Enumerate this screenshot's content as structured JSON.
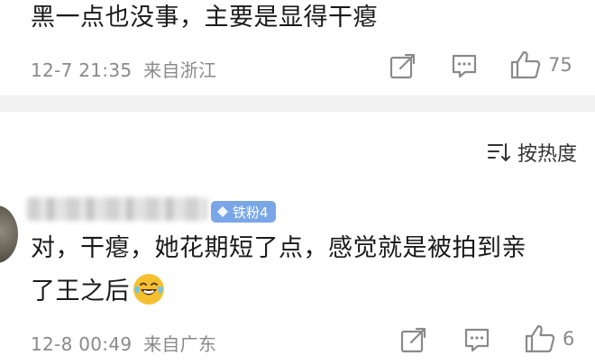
{
  "comment1": {
    "text": "黑一点也没事，主要是显得干瘪",
    "time": "12-7 21:35",
    "source": "来自浙江",
    "like_count": "75",
    "icons": [
      "share-icon",
      "reply-icon",
      "like-icon"
    ]
  },
  "sort": {
    "label": "按热度",
    "icon": "sort-icon"
  },
  "comment2": {
    "badge_label": "铁粉4",
    "badge_icon": "diamond-icon",
    "text_line1": "对，干瘪，她花期短了点，感觉就是被拍到亲",
    "text_line2": "了王之后",
    "emoji": "laughing-crying-emoji",
    "time": "12-8 00:49",
    "source": "来自广东",
    "like_count": "6",
    "icons": [
      "share-icon",
      "reply-icon",
      "like-icon"
    ]
  },
  "colors": {
    "text": "#1a1a1a",
    "meta": "#8a8a8a",
    "divider": "#f2f2f2",
    "badge": "#7aa6e8"
  }
}
